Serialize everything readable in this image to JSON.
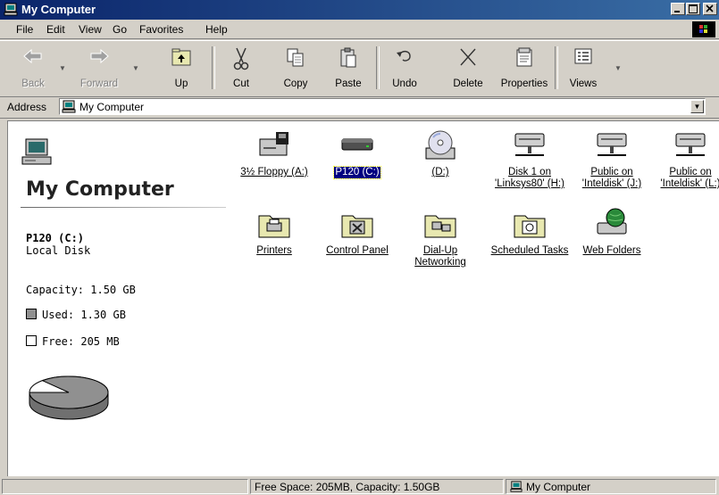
{
  "window": {
    "title": "My Computer"
  },
  "menu": [
    "File",
    "Edit",
    "View",
    "Go",
    "Favorites",
    "Help"
  ],
  "toolbar": {
    "back": "Back",
    "forward": "Forward",
    "up": "Up",
    "cut": "Cut",
    "copy": "Copy",
    "paste": "Paste",
    "undo": "Undo",
    "delete": "Delete",
    "properties": "Properties",
    "views": "Views"
  },
  "address": {
    "label": "Address",
    "value": "My Computer"
  },
  "left_pane": {
    "title": "My Computer",
    "drive": "P120 (C:)",
    "drive_type": "Local Disk",
    "capacity": "Capacity: 1.50 GB",
    "used": "Used: 1.30 GB",
    "free": "Free: 205 MB",
    "used_fraction": 0.867
  },
  "items": [
    {
      "label": "3½ Floppy (A:)",
      "icon": "floppy-drive-icon"
    },
    {
      "label": "P120 (C:)",
      "icon": "hard-drive-icon",
      "selected": true
    },
    {
      "label": "(D:)",
      "icon": "cd-drive-icon"
    },
    {
      "label": "Disk 1 on 'Linksys80' (H:)",
      "icon": "network-drive-icon"
    },
    {
      "label": "Public on 'Inteldisk' (J:)",
      "icon": "network-drive-icon"
    },
    {
      "label": "Public on 'Inteldisk' (L:)",
      "icon": "network-drive-icon"
    },
    {
      "label": "Printers",
      "icon": "printers-folder-icon"
    },
    {
      "label": "Control Panel",
      "icon": "control-panel-icon"
    },
    {
      "label": "Dial-Up Networking",
      "icon": "dialup-networking-icon"
    },
    {
      "label": "Scheduled Tasks",
      "icon": "scheduled-tasks-icon"
    },
    {
      "label": "Web Folders",
      "icon": "web-folders-icon"
    }
  ],
  "status": {
    "info": "Free Space: 205MB, Capacity: 1.50GB",
    "location": "My Computer"
  }
}
